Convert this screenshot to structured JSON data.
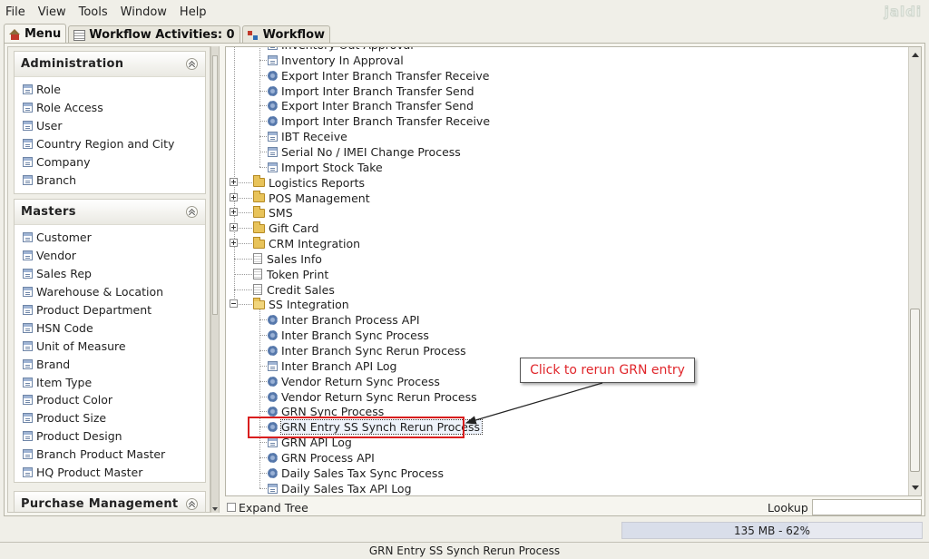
{
  "menubar": [
    "File",
    "View",
    "Tools",
    "Window",
    "Help"
  ],
  "logo": "jaldi",
  "tabs": [
    {
      "label": "Menu",
      "icon": "home-icon",
      "active": true
    },
    {
      "label": "Workflow Activities: 0",
      "icon": "document-icon",
      "active": false
    },
    {
      "label": "Workflow",
      "icon": "workflow-icon",
      "active": false
    }
  ],
  "sidebar": {
    "groups": [
      {
        "title": "Administration",
        "items": [
          "Role",
          "Role Access",
          "User",
          "Country Region and City",
          "Company",
          "Branch"
        ]
      },
      {
        "title": "Masters",
        "items": [
          "Customer",
          "Vendor",
          "Sales Rep",
          "Warehouse & Location",
          "Product Department",
          "HSN Code",
          "Unit of Measure",
          "Brand",
          "Item Type",
          "Product Color",
          "Product Size",
          "Product Design",
          "Branch Product Master",
          "HQ Product Master"
        ]
      },
      {
        "title": "Purchase Management",
        "items": []
      }
    ]
  },
  "tree": {
    "rows": [
      {
        "label": "Inventory Out Approval",
        "icon": "form",
        "level": 2
      },
      {
        "label": "Inventory In Approval",
        "icon": "form",
        "level": 2
      },
      {
        "label": "Export Inter Branch Transfer Receive",
        "icon": "gear",
        "level": 2
      },
      {
        "label": "Import Inter Branch Transfer Send",
        "icon": "gear",
        "level": 2
      },
      {
        "label": "Export Inter Branch Transfer Send",
        "icon": "gear",
        "level": 2
      },
      {
        "label": "Import Inter Branch Transfer Receive",
        "icon": "gear",
        "level": 2
      },
      {
        "label": "IBT Receive",
        "icon": "form",
        "level": 2
      },
      {
        "label": "Serial No / IMEI Change Process",
        "icon": "form",
        "level": 2
      },
      {
        "label": "Import Stock Take",
        "icon": "form",
        "level": 2
      },
      {
        "label": "Logistics Reports",
        "icon": "folder",
        "level": 1,
        "expander": "plus"
      },
      {
        "label": "POS Management",
        "icon": "folder",
        "level": 1,
        "expander": "plus"
      },
      {
        "label": "SMS",
        "icon": "folder",
        "level": 1,
        "expander": "plus"
      },
      {
        "label": "Gift Card",
        "icon": "folder",
        "level": 1,
        "expander": "plus"
      },
      {
        "label": "CRM Integration",
        "icon": "folder",
        "level": 1,
        "expander": "plus"
      },
      {
        "label": "Sales Info",
        "icon": "page",
        "level": 1
      },
      {
        "label": "Token Print",
        "icon": "page",
        "level": 1
      },
      {
        "label": "Credit Sales",
        "icon": "page",
        "level": 1
      },
      {
        "label": "SS Integration",
        "icon": "folder-open",
        "level": 1,
        "expander": "minus"
      },
      {
        "label": "Inter Branch Process API",
        "icon": "gear",
        "level": 2
      },
      {
        "label": "Inter Branch Sync Process",
        "icon": "gear",
        "level": 2
      },
      {
        "label": "Inter Branch Sync Rerun Process",
        "icon": "gear",
        "level": 2
      },
      {
        "label": "Inter Branch API Log",
        "icon": "form",
        "level": 2
      },
      {
        "label": "Vendor Return Sync Process",
        "icon": "gear",
        "level": 2
      },
      {
        "label": "Vendor Return Sync Rerun Process",
        "icon": "gear",
        "level": 2
      },
      {
        "label": "GRN Sync Process",
        "icon": "gear",
        "level": 2
      },
      {
        "label": "GRN Entry SS Synch Rerun Process",
        "icon": "gear",
        "level": 2,
        "selected": true
      },
      {
        "label": "GRN API Log",
        "icon": "form",
        "level": 2
      },
      {
        "label": "GRN Process API",
        "icon": "gear",
        "level": 2
      },
      {
        "label": "Daily Sales Tax Sync Process",
        "icon": "gear",
        "level": 2
      },
      {
        "label": "Daily Sales Tax API Log",
        "icon": "form",
        "level": 2
      }
    ]
  },
  "callout": {
    "text": "Click to rerun GRN entry",
    "color": "#e0262b"
  },
  "bottom": {
    "expand_tree": "Expand Tree",
    "lookup": "Lookup",
    "lookup_value": ""
  },
  "memory": {
    "text": "135 MB - 62%",
    "fraction": 0.62
  },
  "statusbar": "GRN Entry SS Synch Rerun Process"
}
